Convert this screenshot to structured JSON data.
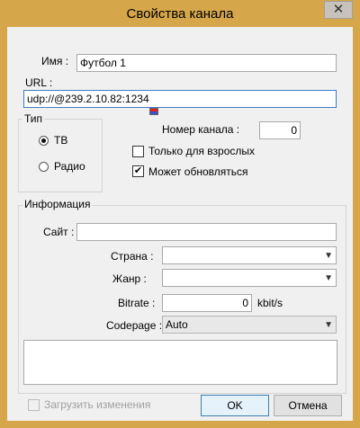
{
  "window": {
    "title": "Свойства канала",
    "close_glyph": "✕"
  },
  "fields": {
    "name_label": "Имя :",
    "name_value": "Футбол 1",
    "url_label": "URL :",
    "url_value": "udp://@239.2.10.82:1234"
  },
  "type_group": {
    "title": "Тип",
    "options": [
      {
        "label": "ТВ",
        "selected": true
      },
      {
        "label": "Радио",
        "selected": false
      }
    ]
  },
  "channel": {
    "number_label": "Номер канала :",
    "number_value": "0",
    "adult_label": "Только для взрослых",
    "adult_checked": false,
    "updatable_label": "Может обновляться",
    "updatable_checked": true
  },
  "info_group": {
    "title": "Информация",
    "site_label": "Сайт :",
    "site_value": "",
    "country_label": "Страна :",
    "country_value": "",
    "genre_label": "Жанр :",
    "genre_value": "",
    "bitrate_label": "Bitrate :",
    "bitrate_value": "0",
    "bitrate_unit": "kbit/s",
    "codepage_label": "Codepage :",
    "codepage_value": "Auto"
  },
  "footer": {
    "load_changes_label": "Загрузить изменения",
    "load_changes_checked": false,
    "ok_label": "OK",
    "cancel_label": "Отмена"
  },
  "icons": {
    "close": "close-icon",
    "chevron": "chevron-down-icon",
    "check": "check-icon",
    "url_badge": "flag-icon"
  }
}
